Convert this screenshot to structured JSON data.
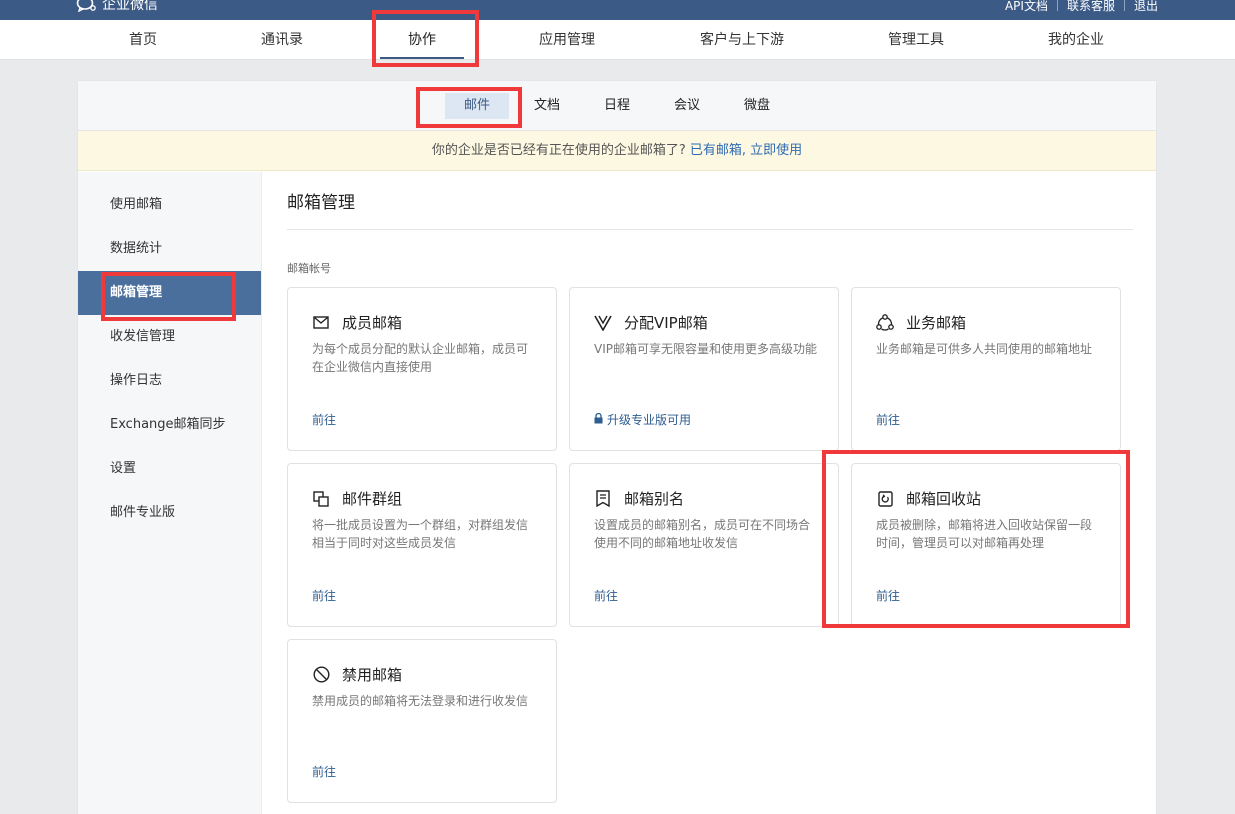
{
  "brand": {
    "logo_text": "企业微信"
  },
  "toplinks": [
    "API文档",
    "联系客服",
    "退出"
  ],
  "mainnav": {
    "items": [
      "首页",
      "通讯录",
      "协作",
      "应用管理",
      "客户与上下游",
      "管理工具",
      "我的企业"
    ],
    "active_index": 2
  },
  "subnav": {
    "items": [
      "邮件",
      "文档",
      "日程",
      "会议",
      "微盘"
    ],
    "active_index": 0
  },
  "notice": {
    "text": "你的企业是否已经有正在使用的企业邮箱了?",
    "link": "已有邮箱, 立即使用"
  },
  "sidebar": {
    "items": [
      "使用邮箱",
      "数据统计",
      "邮箱管理",
      "收发信管理",
      "操作日志",
      "Exchange邮箱同步",
      "设置",
      "邮件专业版"
    ],
    "active_index": 2
  },
  "content": {
    "title": "邮箱管理",
    "section_label": "邮箱帐号",
    "cards": [
      {
        "icon": "mail-icon",
        "title": "成员邮箱",
        "desc": "为每个成员分配的默认企业邮箱，成员可在企业微信内直接使用",
        "link": "前往"
      },
      {
        "icon": "vip-icon",
        "title": "分配VIP邮箱",
        "desc": "VIP邮箱可享无限容量和使用更多高级功能",
        "link": "升级专业版可用",
        "locked": true
      },
      {
        "icon": "business-mailbox-icon",
        "title": "业务邮箱",
        "desc": "业务邮箱是可供多人共同使用的邮箱地址",
        "link": "前往"
      },
      {
        "icon": "mail-group-icon",
        "title": "邮件群组",
        "desc": "将一批成员设置为一个群组，对群组发信相当于同时对这些成员发信",
        "link": "前往"
      },
      {
        "icon": "mail-alias-icon",
        "title": "邮箱别名",
        "desc": "设置成员的邮箱别名，成员可在不同场合使用不同的邮箱地址收发信",
        "link": "前往"
      },
      {
        "icon": "recycle-bin-icon",
        "title": "邮箱回收站",
        "desc": "成员被删除，邮箱将进入回收站保留一段时间，管理员可以对邮箱再处理",
        "link": "前往"
      },
      {
        "icon": "disabled-mailbox-icon",
        "title": "禁用邮箱",
        "desc": "禁用成员的邮箱将无法登录和进行收发信",
        "link": "前往"
      }
    ]
  },
  "colors": {
    "topbar": "#3b5a86",
    "highlight": "#f0393a",
    "accent_link": "#2f6ab3",
    "active_side": "#4a6f9d"
  }
}
